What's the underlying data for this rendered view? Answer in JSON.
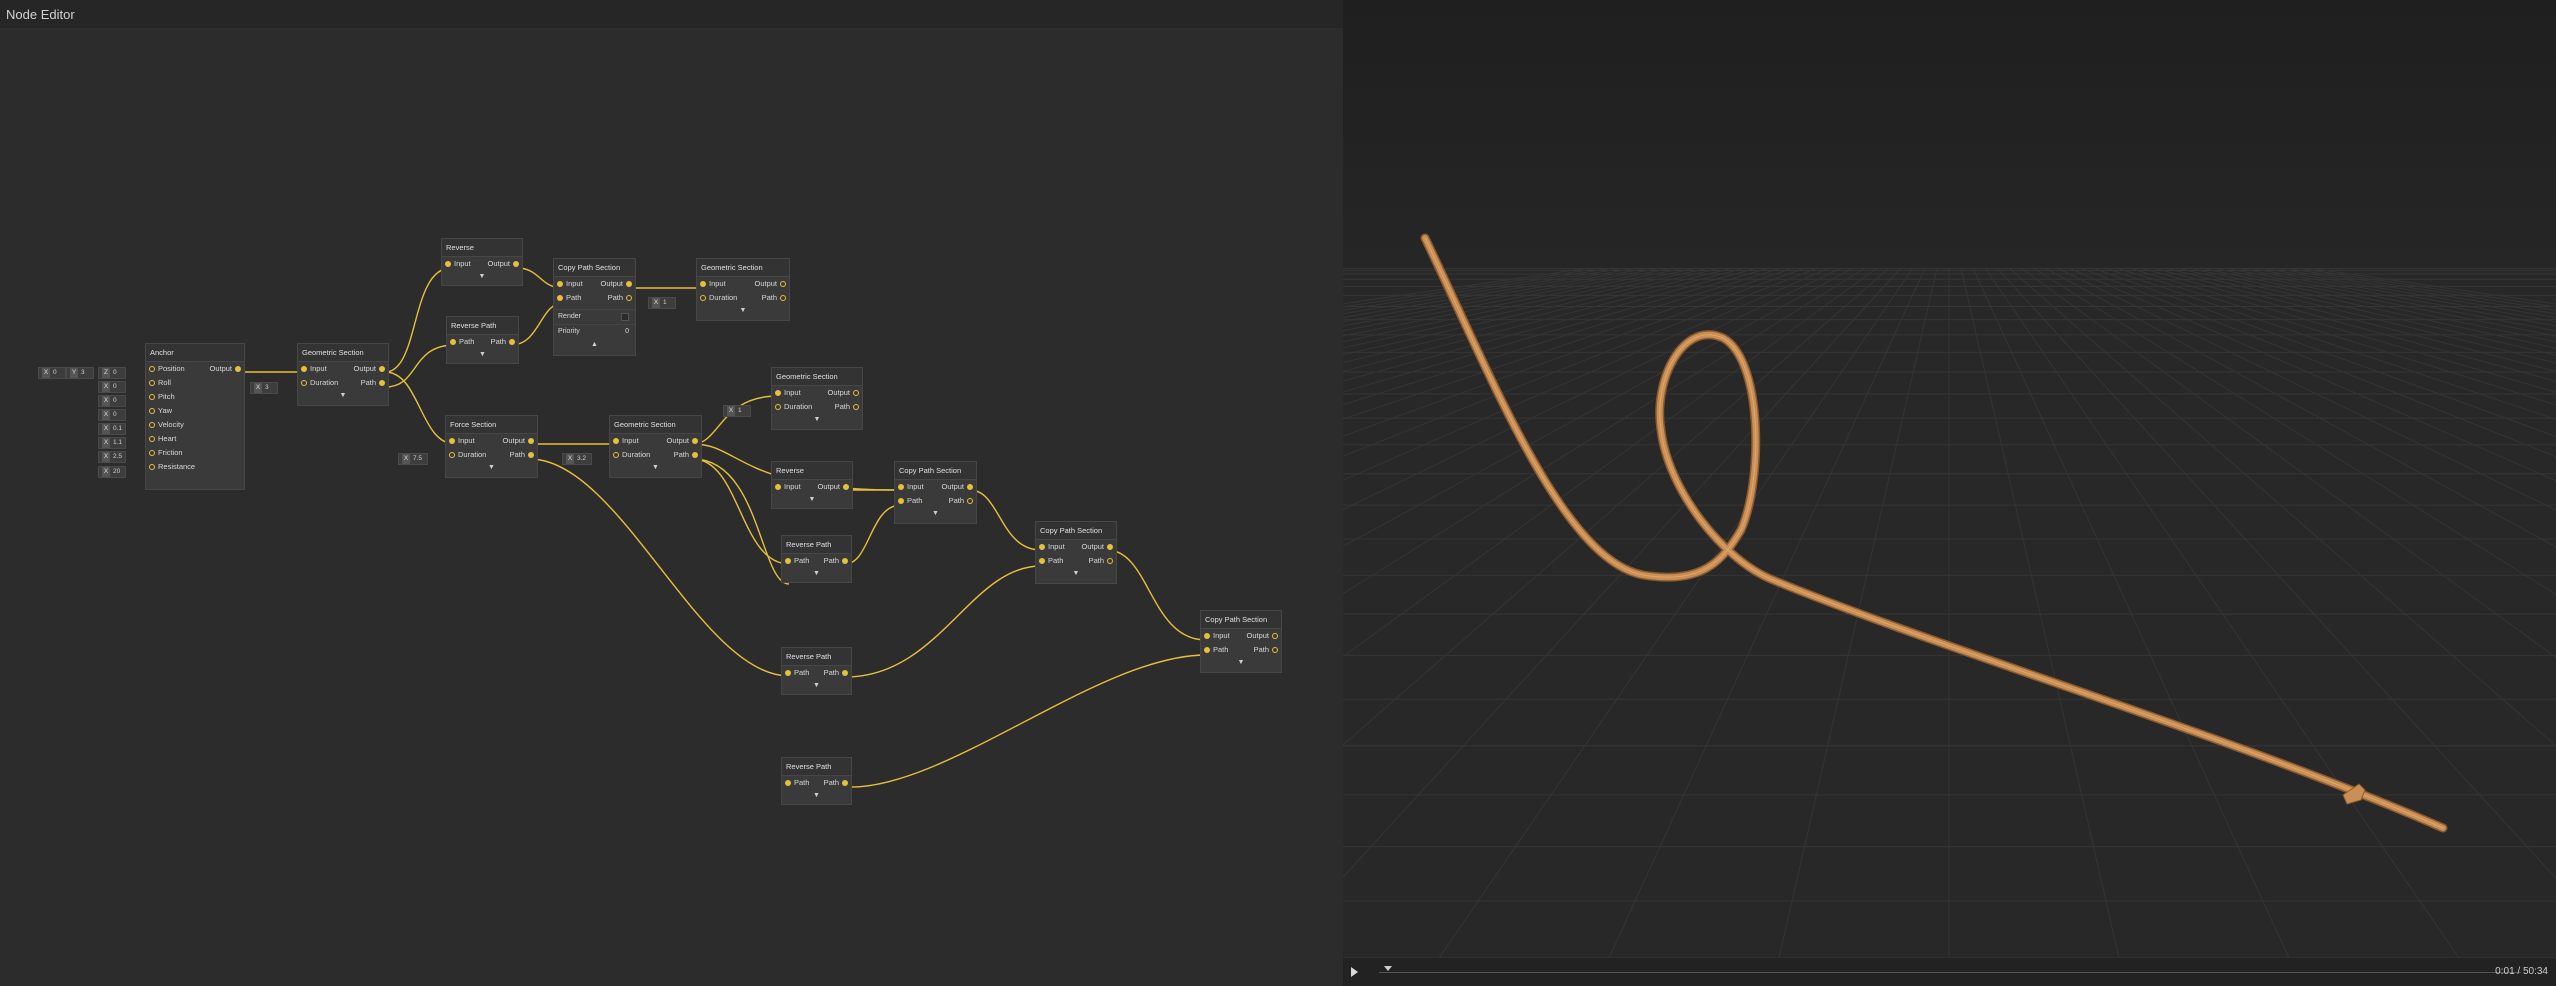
{
  "editor": {
    "title": "Node Editor"
  },
  "nodes": {
    "anchor": {
      "title": "Anchor",
      "output": "Output",
      "inputs": [
        "Position",
        "Roll",
        "Pitch",
        "Yaw",
        "Velocity",
        "Heart",
        "Friction",
        "Resistance"
      ]
    },
    "geo1": {
      "title": "Geometric Section",
      "in1": "Input",
      "in2": "Duration",
      "out1": "Output",
      "out2": "Path"
    },
    "reverse1": {
      "title": "Reverse",
      "in1": "Input",
      "out1": "Output"
    },
    "revpath1": {
      "title": "Reverse Path",
      "in1": "Path",
      "out1": "Path"
    },
    "copy1": {
      "title": "Copy Path Section",
      "in1": "Input",
      "in2": "Path",
      "out1": "Output",
      "out2": "Path",
      "prop_render": "Render",
      "prop_priority": "Priority",
      "priority_value": "0"
    },
    "geo2": {
      "title": "Geometric Section",
      "in1": "Input",
      "in2": "Duration",
      "out1": "Output",
      "out2": "Path"
    },
    "force": {
      "title": "Force Section",
      "in1": "Input",
      "in2": "Duration",
      "out1": "Output",
      "out2": "Path"
    },
    "geo3": {
      "title": "Geometric Section",
      "in1": "Input",
      "in2": "Duration",
      "out1": "Output",
      "out2": "Path"
    },
    "geo4": {
      "title": "Geometric Section",
      "in1": "Input",
      "in2": "Duration",
      "out1": "Output",
      "out2": "Path"
    },
    "reverse2": {
      "title": "Reverse",
      "in1": "Input",
      "out1": "Output"
    },
    "copy2": {
      "title": "Copy Path Section",
      "in1": "Input",
      "in2": "Path",
      "out1": "Output",
      "out2": "Path"
    },
    "revpath2": {
      "title": "Reverse Path",
      "in1": "Path",
      "out1": "Path"
    },
    "copy3": {
      "title": "Copy Path Section",
      "in1": "Input",
      "in2": "Path",
      "out1": "Output",
      "out2": "Path"
    },
    "revpath3": {
      "title": "Reverse Path",
      "in1": "Path",
      "out1": "Path"
    },
    "copy4": {
      "title": "Copy Path Section",
      "in1": "Input",
      "in2": "Path",
      "out1": "Output",
      "out2": "Path"
    },
    "revpath4": {
      "title": "Reverse Path",
      "in1": "Path",
      "out1": "Path"
    }
  },
  "values": {
    "pos_x": {
      "axis": "X",
      "value": "0"
    },
    "pos_y": {
      "axis": "Y",
      "value": "3"
    },
    "pos_z": {
      "axis": "Z",
      "value": "0"
    },
    "roll": {
      "axis": "X",
      "value": "0"
    },
    "pitch": {
      "axis": "X",
      "value": "0"
    },
    "yaw": {
      "axis": "X",
      "value": "0"
    },
    "velocity": {
      "axis": "X",
      "value": "0.1"
    },
    "heart": {
      "axis": "X",
      "value": "1.1"
    },
    "friction": {
      "axis": "X",
      "value": "2.5"
    },
    "resistance": {
      "axis": "X",
      "value": "20"
    },
    "geo1_duration": {
      "axis": "X",
      "value": "3"
    },
    "geo2_duration": {
      "axis": "X",
      "value": "1"
    },
    "force_duration": {
      "axis": "X",
      "value": "7.5"
    },
    "geo3_duration": {
      "axis": "X",
      "value": "3.2"
    },
    "geo4_duration": {
      "axis": "X",
      "value": "1"
    }
  },
  "ui": {
    "collapse_down": "▼",
    "collapse_up": "▲"
  },
  "timeline": {
    "time": "0:01 / 50:34"
  },
  "colors": {
    "wire": "#e6c03a",
    "track": "#c98f55",
    "editor_bg": "#2c2c2c",
    "viewport_bg": "#1f1f1f"
  }
}
